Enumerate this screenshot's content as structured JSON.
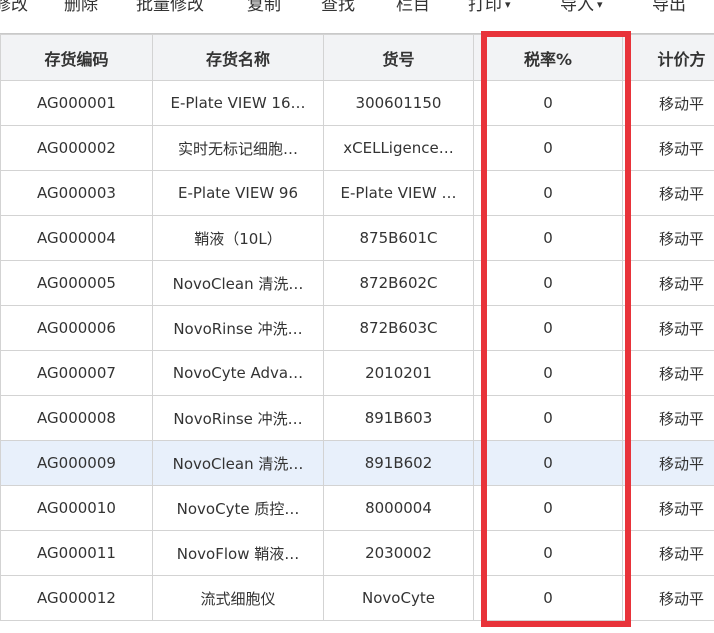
{
  "toolbar": {
    "items": [
      {
        "label": "修改"
      },
      {
        "label": "删除"
      },
      {
        "label": "批量修改"
      },
      {
        "label": "复制"
      },
      {
        "label": "查找"
      },
      {
        "label": "栏目"
      },
      {
        "label": "打印",
        "dropdown": true
      },
      {
        "label": "导入",
        "dropdown": true
      },
      {
        "label": "导出"
      }
    ],
    "caret": "▾"
  },
  "table": {
    "headers": {
      "code": "存货编码",
      "name": "存货名称",
      "item_no": "货号",
      "tax_rate": "税率%",
      "price_method": "计价方"
    },
    "rows": [
      {
        "code": "AG000001",
        "name": "E-Plate VIEW 16…",
        "item_no": "300601150",
        "tax_rate": "0",
        "price_method": "移动平"
      },
      {
        "code": "AG000002",
        "name": "实时无标记细胞…",
        "item_no": "xCELLigence…",
        "tax_rate": "0",
        "price_method": "移动平"
      },
      {
        "code": "AG000003",
        "name": "E-Plate VIEW 96",
        "item_no": "E-Plate VIEW …",
        "tax_rate": "0",
        "price_method": "移动平"
      },
      {
        "code": "AG000004",
        "name": "鞘液（10L）",
        "item_no": "875B601C",
        "tax_rate": "0",
        "price_method": "移动平"
      },
      {
        "code": "AG000005",
        "name": "NovoClean 清洗…",
        "item_no": "872B602C",
        "tax_rate": "0",
        "price_method": "移动平"
      },
      {
        "code": "AG000006",
        "name": "NovoRinse 冲洗…",
        "item_no": "872B603C",
        "tax_rate": "0",
        "price_method": "移动平"
      },
      {
        "code": "AG000007",
        "name": "NovoCyte Adva…",
        "item_no": "2010201",
        "tax_rate": "0",
        "price_method": "移动平"
      },
      {
        "code": "AG000008",
        "name": "NovoRinse 冲洗…",
        "item_no": "891B603",
        "tax_rate": "0",
        "price_method": "移动平"
      },
      {
        "code": "AG000009",
        "name": "NovoClean 清洗…",
        "item_no": "891B602",
        "tax_rate": "0",
        "price_method": "移动平",
        "selected": true
      },
      {
        "code": "AG000010",
        "name": "NovoCyte 质控…",
        "item_no": "8000004",
        "tax_rate": "0",
        "price_method": "移动平"
      },
      {
        "code": "AG000011",
        "name": "NovoFlow 鞘液…",
        "item_no": "2030002",
        "tax_rate": "0",
        "price_method": "移动平"
      },
      {
        "code": "AG000012",
        "name": "流式细胞仪",
        "item_no": "NovoCyte",
        "tax_rate": "0",
        "price_method": "移动平"
      }
    ]
  },
  "colors": {
    "highlight": "#e8333a",
    "header_bg": "#f2f3f5",
    "selected_row_bg": "#e8f0fb",
    "border": "#d3d3d3"
  }
}
